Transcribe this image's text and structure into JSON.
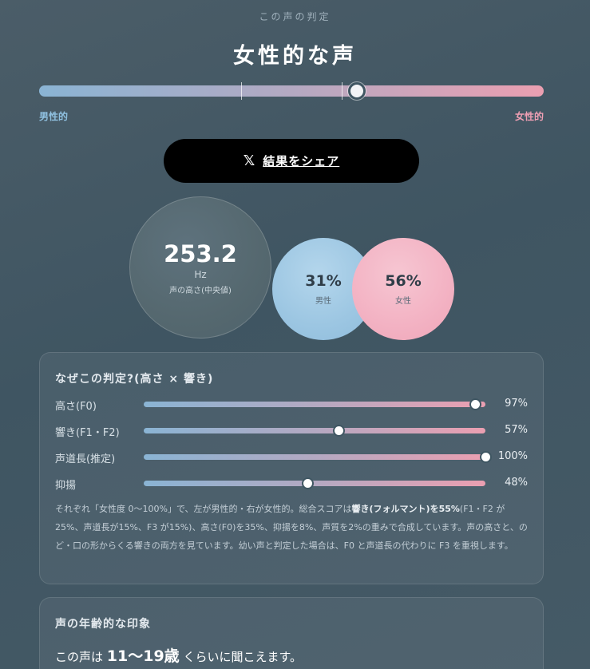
{
  "header": {
    "eyebrow": "この声の判定",
    "verdict": "女性的な声"
  },
  "main_scale": {
    "male_label": "男性的",
    "female_label": "女性的",
    "score_fraction": 0.63,
    "tick_fractions": [
      0.4,
      0.6
    ]
  },
  "share": {
    "icon": "x-logo-icon",
    "icon_glyph": "𝕏",
    "label": "結果をシェア"
  },
  "pitch": {
    "value": "253.2",
    "unit": "Hz",
    "caption": "声の高さ(中央値)"
  },
  "gender_pct": {
    "male_value": "31%",
    "male_label": "男性",
    "female_value": "56%",
    "female_label": "女性"
  },
  "reason": {
    "title": "なぜこの判定?(高さ × 響き)",
    "metrics": [
      {
        "label": "高さ(F0)",
        "value": "97%",
        "fraction": 0.97
      },
      {
        "label": "響き(F1・F2)",
        "value": "57%",
        "fraction": 0.57
      },
      {
        "label": "声道長(推定)",
        "value": "100%",
        "fraction": 1.0
      },
      {
        "label": "抑揚",
        "value": "48%",
        "fraction": 0.48
      }
    ],
    "note_pre": "それぞれ「女性度 0〜100%」で、左が男性的・右が女性的。総合スコアは",
    "note_bold": "響き(フォルマント)を55%",
    "note_post": "(F1・F2 が25%、声道長が15%、F3 が15%)、高さ(F0)を35%、抑揚を8%、声質を2%の重みで合成しています。声の高さと、のど・口の形からくる響きの両方を見ています。幼い声と判定した場合は、F0 と声道長の代わりに F3 を重視します。"
  },
  "age": {
    "title": "声の年齢的な印象",
    "prefix": "この声は",
    "range": "11〜19歳",
    "suffix": "くらいに聞こえます。"
  },
  "colors": {
    "male": "#8ab4d4",
    "female": "#eb9fb1",
    "background": "#43585f"
  }
}
